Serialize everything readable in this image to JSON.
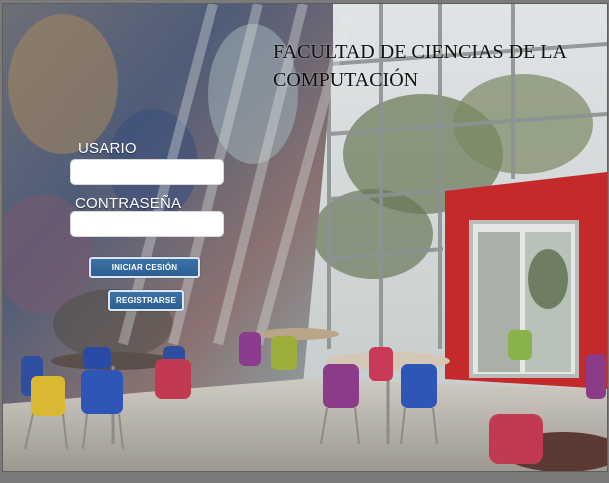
{
  "page": {
    "title": "FACULTAD DE CIENCIAS DE LA COMPUTACIÓN"
  },
  "login": {
    "user_label": "USARIO",
    "password_label": "CONTRASEÑA",
    "user_value": "",
    "password_value": "",
    "login_button": "INICIAR  CESIÓN",
    "register_button": "REGISTRARSE"
  },
  "colors": {
    "button_fill": "#2f6398",
    "button_border": "#d9e6f2",
    "label_text": "#ffffff",
    "title_text": "#111111"
  },
  "icons": []
}
